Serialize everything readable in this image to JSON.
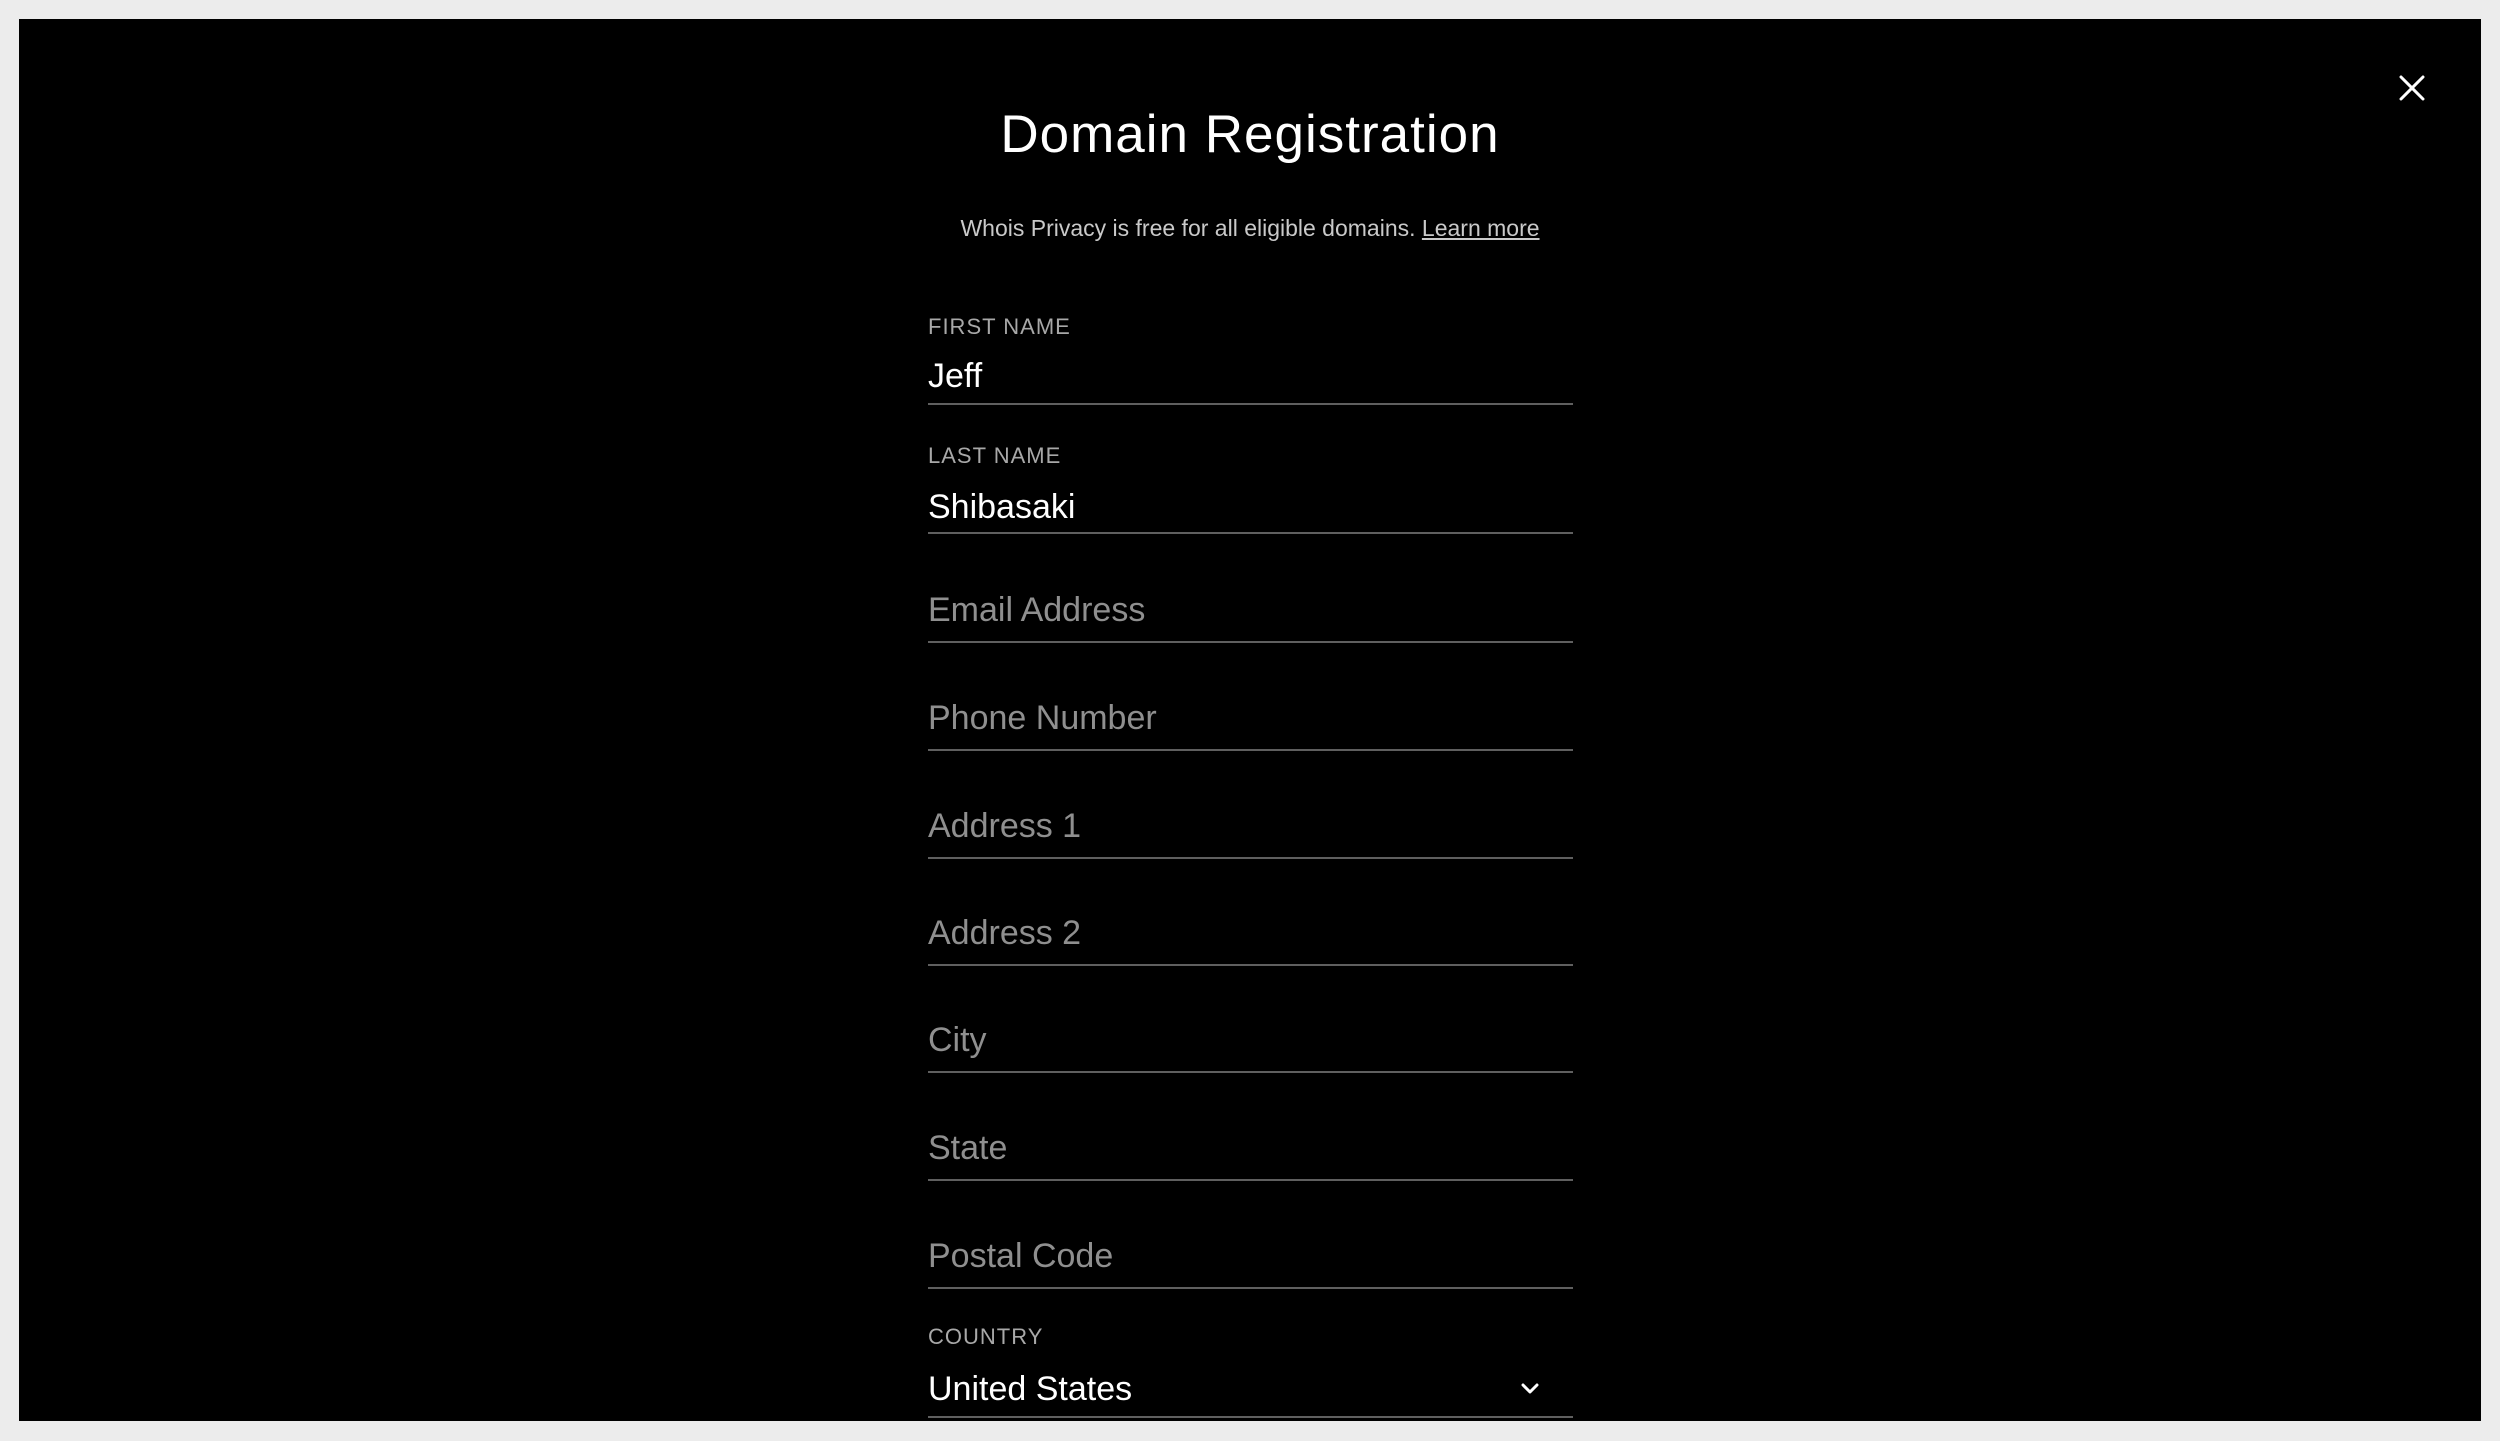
{
  "dialog": {
    "title": "Domain Registration",
    "subtitle_text": "Whois Privacy is free for all eligible domains.",
    "learn_more_label": "Learn more",
    "close_icon": "close-icon"
  },
  "form": {
    "first_name": {
      "label": "FIRST NAME",
      "value": "Jeff"
    },
    "last_name": {
      "label": "LAST NAME",
      "value": "Shibasaki"
    },
    "email": {
      "placeholder": "Email Address"
    },
    "phone": {
      "placeholder": "Phone Number"
    },
    "address1": {
      "placeholder": "Address 1"
    },
    "address2": {
      "placeholder": "Address 2"
    },
    "city": {
      "placeholder": "City"
    },
    "state": {
      "placeholder": "State"
    },
    "postal_code": {
      "placeholder": "Postal Code"
    },
    "country": {
      "label": "COUNTRY",
      "value": "United States",
      "icon": "chevron-down-icon"
    }
  },
  "colors": {
    "background": "#000000",
    "text": "#ffffff",
    "label": "#a8a8a8",
    "placeholder": "#8f8f8f",
    "underline": "#5f5f5f"
  }
}
